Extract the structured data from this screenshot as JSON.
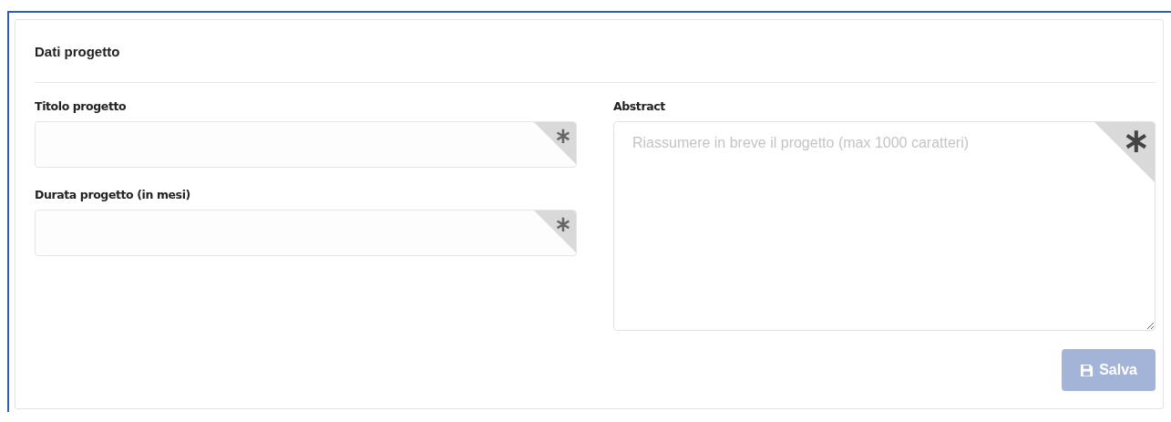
{
  "panel": {
    "title": "Dati progetto"
  },
  "left_fields": [
    {
      "label": "Titolo progetto",
      "required": true
    },
    {
      "label": "Durata progetto (in mesi)",
      "required": true
    }
  ],
  "abstract": {
    "label": "Abstract",
    "placeholder": "Riassumere in breve il progetto (max 1000 caratteri)",
    "required": true
  },
  "save_button": {
    "label": "Salva",
    "disabled": true
  }
}
